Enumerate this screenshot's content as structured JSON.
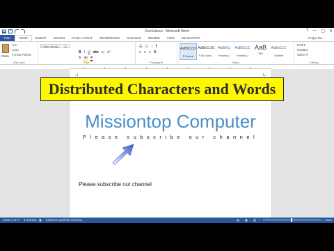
{
  "window": {
    "title": "DocSubocs - Microsoft Word",
    "controls": [
      "?",
      "—",
      "▢",
      "✕"
    ]
  },
  "ribbon": {
    "tabs": [
      "FILE",
      "HOME",
      "INSERT",
      "DESIGN",
      "PAGE LAYOUT",
      "REFERENCES",
      "MAILINGS",
      "REVIEW",
      "VIEW",
      "DEVELOPER"
    ],
    "active_tab": "HOME",
    "user": "Prajan Ra...",
    "clipboard": {
      "paste": "Paste",
      "cut": "Cut",
      "copy": "Copy",
      "format_painter": "Format Painter",
      "label": "Clipboard"
    },
    "font": {
      "name": "Calibri (Body)",
      "size": "11",
      "label": "Font"
    },
    "paragraph_label": "Paragraph",
    "styles": [
      {
        "preview": "AaBbCcDc",
        "name": "¶ Normal"
      },
      {
        "preview": "AaBbCcDc",
        "name": "¶ No Spac..."
      },
      {
        "preview": "AaBbCc",
        "name": "Heading 1"
      },
      {
        "preview": "AaBbCcC",
        "name": "Heading 2"
      },
      {
        "preview": "AaB",
        "name": "Title"
      },
      {
        "preview": "AaBbCcC",
        "name": "Subtitle"
      }
    ],
    "styles_label": "Styles",
    "editing": {
      "find": "Find ▾",
      "replace": "Replace",
      "select": "Select ▾",
      "label": "Editing"
    }
  },
  "document": {
    "heading": "Missiontop Computer",
    "spaced_line": "Please subscribe our channel",
    "plain_line": "Please subscribe our channel"
  },
  "banner": {
    "text": "Distributed Characters and Words"
  },
  "status": {
    "page": "PAGE 1 OF 1",
    "words": "8 WORDS",
    "language": "ENGLISH (UNITED STATES)",
    "zoom": "130%"
  },
  "colors": {
    "accent": "#2b579a",
    "heading": "#4a8fc9",
    "banner": "#fdf800",
    "arrow": "#3a56c8"
  }
}
